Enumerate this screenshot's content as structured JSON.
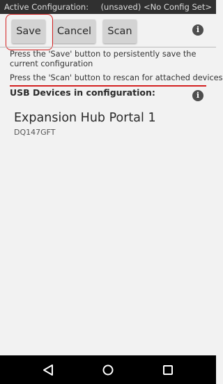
{
  "status_bar": {
    "left": "Active Configuration:",
    "right": "(unsaved) <No Config Set>"
  },
  "toolbar": {
    "save_label": "Save",
    "cancel_label": "Cancel",
    "scan_label": "Scan",
    "info_icon": "info-icon"
  },
  "help": {
    "save_text": "Press the 'Save' button to persistently save the current configuration",
    "scan_text": "Press the 'Scan' button to rescan for attached devices"
  },
  "usb": {
    "heading": "USB Devices in configuration:",
    "info_icon": "info-icon",
    "devices": [
      {
        "name": "Expansion Hub Portal 1",
        "serial": "DQ147GFT"
      }
    ]
  },
  "annotations": {
    "highlight_color": "#d42020"
  },
  "nav_bar": {
    "icons": [
      "back-icon",
      "home-icon",
      "recent-apps-icon"
    ]
  }
}
